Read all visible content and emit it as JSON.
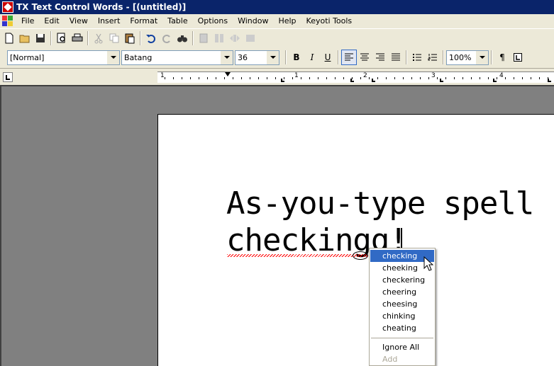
{
  "window": {
    "title": "TX Text Control Words - [(untitled)]"
  },
  "menu": {
    "items": [
      "File",
      "Edit",
      "View",
      "Insert",
      "Format",
      "Table",
      "Options",
      "Window",
      "Help",
      "Keyoti Tools"
    ]
  },
  "format_toolbar": {
    "style_value": "[Normal]",
    "font_value": "Batang",
    "size_value": "36",
    "bold_label": "B",
    "italic_label": "I",
    "underline_label": "U",
    "zoom_value": "100%",
    "pilcrow_label": "¶"
  },
  "ruler": {
    "numbers": [
      "1",
      "1",
      "2",
      "3",
      "4"
    ]
  },
  "document": {
    "line1": "As-you-type spell",
    "line2": "checkingg!"
  },
  "context_menu": {
    "suggestions": [
      "checking",
      "cheeking",
      "checkering",
      "cheering",
      "cheesing",
      "chinking",
      "cheating"
    ],
    "ignore_all": "Ignore All",
    "add": "Add"
  },
  "colors": {
    "highlight": "#316ac5",
    "title_bar": "#0a246a",
    "squiggle": "#ff0000"
  }
}
